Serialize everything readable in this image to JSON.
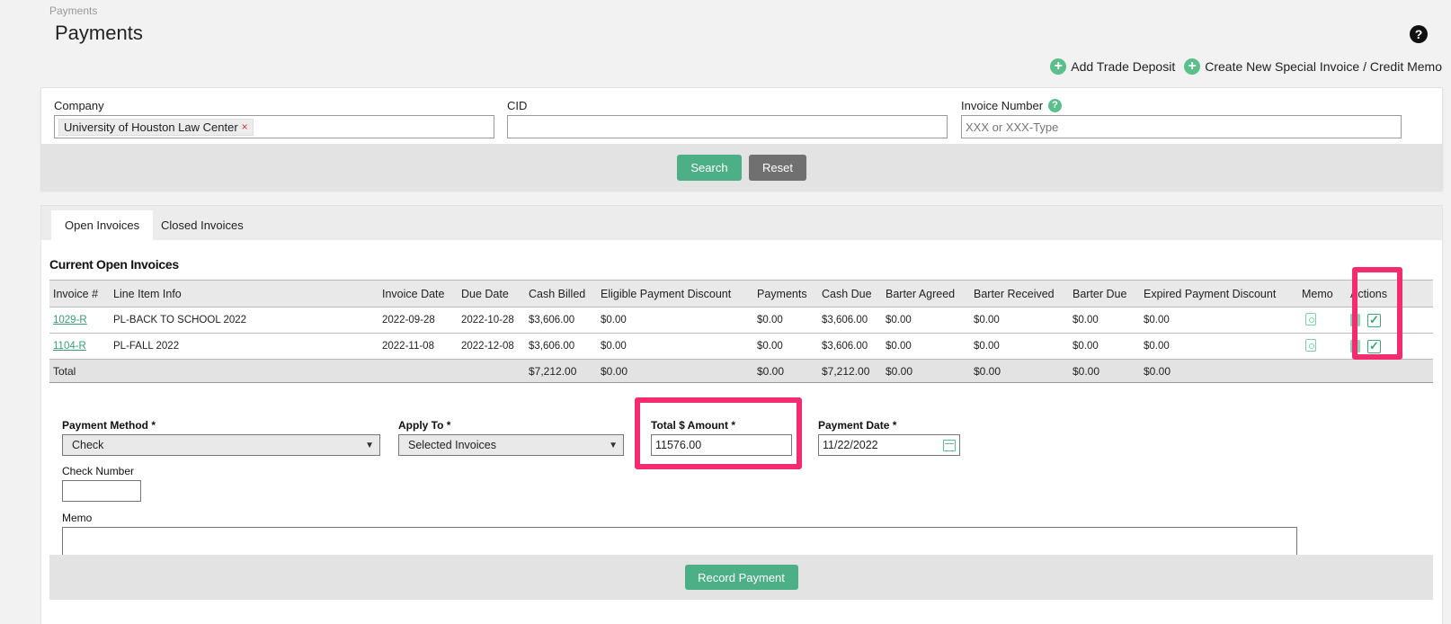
{
  "breadcrumb": "Payments",
  "page_title": "Payments",
  "help_label": "?",
  "top_actions": {
    "add_trade_deposit": "Add Trade Deposit",
    "create_special_invoice": "Create New Special Invoice / Credit Memo"
  },
  "filters": {
    "company_label": "Company",
    "company_value": "University of Houston Law Center",
    "cid_label": "CID",
    "cid_value": "",
    "invoice_number_label": "Invoice Number",
    "invoice_number_placeholder": "XXX or XXX-Type",
    "search_label": "Search",
    "reset_label": "Reset"
  },
  "tabs": {
    "open": "Open Invoices",
    "closed": "Closed Invoices"
  },
  "section_title": "Current Open Invoices",
  "table": {
    "headers": [
      "Invoice #",
      "Line Item Info",
      "Invoice Date",
      "Due Date",
      "Cash Billed",
      "Eligible Payment Discount",
      "Payments",
      "Cash Due",
      "Barter Agreed",
      "Barter Received",
      "Barter Due",
      "Expired Payment Discount",
      "Memo",
      "Actions"
    ],
    "rows": [
      {
        "invoice": "1029-R",
        "line_item": "PL-BACK TO SCHOOL 2022",
        "invoice_date": "2022-09-28",
        "due_date": "2022-10-28",
        "cash_billed": "$3,606.00",
        "eligible_discount": "$0.00",
        "payments": "$0.00",
        "cash_due": "$3,606.00",
        "barter_agreed": "$0.00",
        "barter_received": "$0.00",
        "barter_due": "$0.00",
        "expired_discount": "$0.00"
      },
      {
        "invoice": "1104-R",
        "line_item": "PL-FALL 2022",
        "invoice_date": "2022-11-08",
        "due_date": "2022-12-08",
        "cash_billed": "$3,606.00",
        "eligible_discount": "$0.00",
        "payments": "$0.00",
        "cash_due": "$3,606.00",
        "barter_agreed": "$0.00",
        "barter_received": "$0.00",
        "barter_due": "$0.00",
        "expired_discount": "$0.00"
      }
    ],
    "total": {
      "label": "Total",
      "cash_billed": "$7,212.00",
      "eligible_discount": "$0.00",
      "payments": "$0.00",
      "cash_due": "$7,212.00",
      "barter_agreed": "$0.00",
      "barter_received": "$0.00",
      "barter_due": "$0.00",
      "expired_discount": "$0.00"
    }
  },
  "payment_form": {
    "method_label": "Payment Method *",
    "method_value": "Check",
    "apply_to_label": "Apply To *",
    "apply_to_value": "Selected Invoices",
    "amount_label": "Total $ Amount *",
    "amount_value": "11576.00",
    "date_label": "Payment Date *",
    "date_value": "11/22/2022",
    "check_number_label": "Check Number",
    "check_number_value": "",
    "memo_label": "Memo",
    "record_label": "Record Payment"
  },
  "colors": {
    "accent_green": "#4caf86",
    "highlight_pink": "#f22c6e"
  }
}
